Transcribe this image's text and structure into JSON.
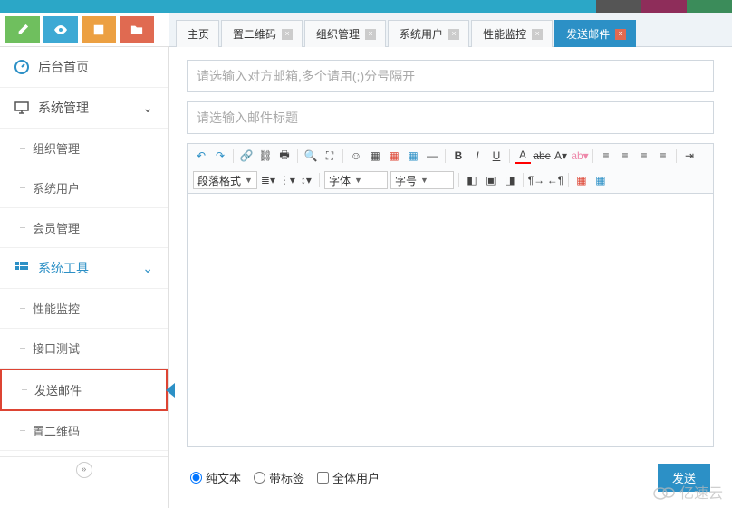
{
  "topbar_colors": [
    "#555555",
    "#8e2d5a",
    "#3b8c5a"
  ],
  "tabs": [
    {
      "label": "主页",
      "closable": false
    },
    {
      "label": "置二维码",
      "closable": true
    },
    {
      "label": "组织管理",
      "closable": true
    },
    {
      "label": "系统用户",
      "closable": true
    },
    {
      "label": "性能监控",
      "closable": true
    },
    {
      "label": "发送邮件",
      "closable": true,
      "active": true
    }
  ],
  "sidebar": {
    "home": {
      "label": "后台首页"
    },
    "group1": {
      "label": "系统管理",
      "items": [
        {
          "label": "组织管理"
        },
        {
          "label": "系统用户"
        },
        {
          "label": "会员管理"
        }
      ]
    },
    "group2": {
      "label": "系统工具",
      "items": [
        {
          "label": "性能监控"
        },
        {
          "label": "接口测试"
        },
        {
          "label": "发送邮件",
          "highlight": true
        },
        {
          "label": "置二维码"
        }
      ]
    }
  },
  "form": {
    "recipient_placeholder": "请选输入对方邮箱,多个请用(;)分号隔开",
    "subject_placeholder": "请选输入邮件标题",
    "format_select": "段落格式",
    "font_family_select": "字体",
    "font_size_select": "字号",
    "radio_plain": "纯文本",
    "radio_tags": "带标签",
    "check_all_users": "全体用户",
    "send_button": "发送"
  },
  "watermark": "亿速云",
  "colors": {
    "primary": "#2c90c6",
    "highlight_border": "#d43"
  }
}
